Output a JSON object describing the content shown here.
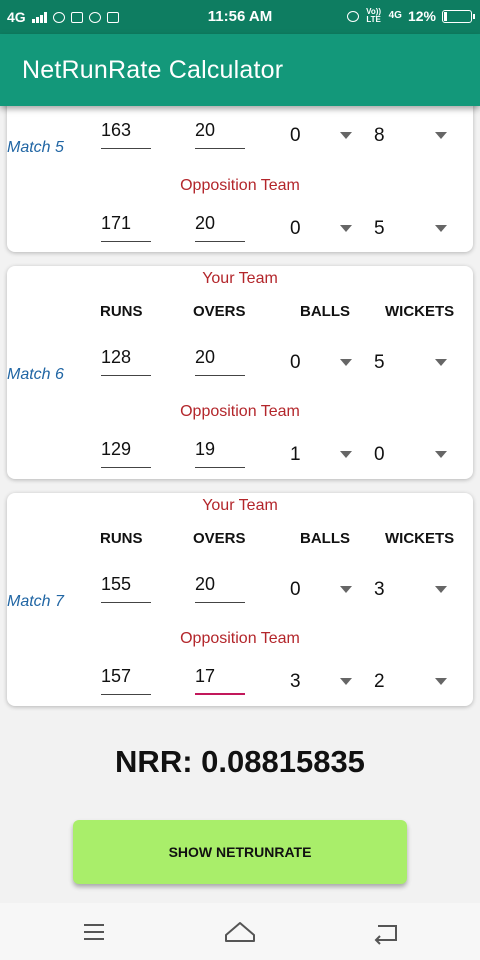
{
  "status_bar": {
    "network": "4G",
    "time": "11:56 AM",
    "volte": "Vo)) LTE",
    "net_type": "4G",
    "battery_percent": "12%",
    "battery_level": 0.12
  },
  "app_title": "NetRunRate Calculator",
  "labels": {
    "your_team": "Your Team",
    "opposition_team": "Opposition Team",
    "col_runs": "RUNS",
    "col_overs": "OVERS",
    "col_balls": "BALLS",
    "col_wickets": "WICKETS"
  },
  "matches": [
    {
      "label": "Match 5",
      "your": {
        "runs": "163",
        "overs": "20",
        "balls": "0",
        "wickets": "8"
      },
      "opp": {
        "runs": "171",
        "overs": "20",
        "balls": "0",
        "wickets": "5"
      }
    },
    {
      "label": "Match 6",
      "your": {
        "runs": "128",
        "overs": "20",
        "balls": "0",
        "wickets": "5"
      },
      "opp": {
        "runs": "129",
        "overs": "19",
        "balls": "1",
        "wickets": "0"
      }
    },
    {
      "label": "Match 7",
      "your": {
        "runs": "155",
        "overs": "20",
        "balls": "0",
        "wickets": "3"
      },
      "opp": {
        "runs": "157",
        "overs": "17",
        "balls": "3",
        "wickets": "2"
      }
    }
  ],
  "result": "NRR: 0.08815835",
  "show_button": "SHOW NETRUNRATE",
  "nav": {
    "menu": "menu-icon",
    "home": "home-icon",
    "back": "back-icon"
  }
}
